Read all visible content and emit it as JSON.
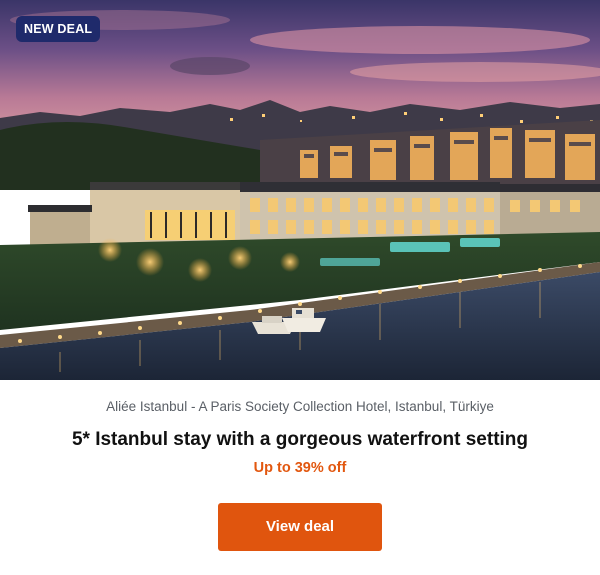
{
  "badge": {
    "label": "NEW DEAL",
    "color": "#1f2a6b"
  },
  "hero_image": {
    "icon": "hotel-waterfront-photo"
  },
  "deal": {
    "location": "Aliée Istanbul - A Paris Society Collection Hotel, Istanbul, Türkiye",
    "title": "5* Istanbul stay with a gorgeous waterfront setting",
    "discount": "Up to 39% off",
    "discount_color": "#e2570f"
  },
  "cta": {
    "label": "View deal",
    "color": "#e0550e"
  }
}
